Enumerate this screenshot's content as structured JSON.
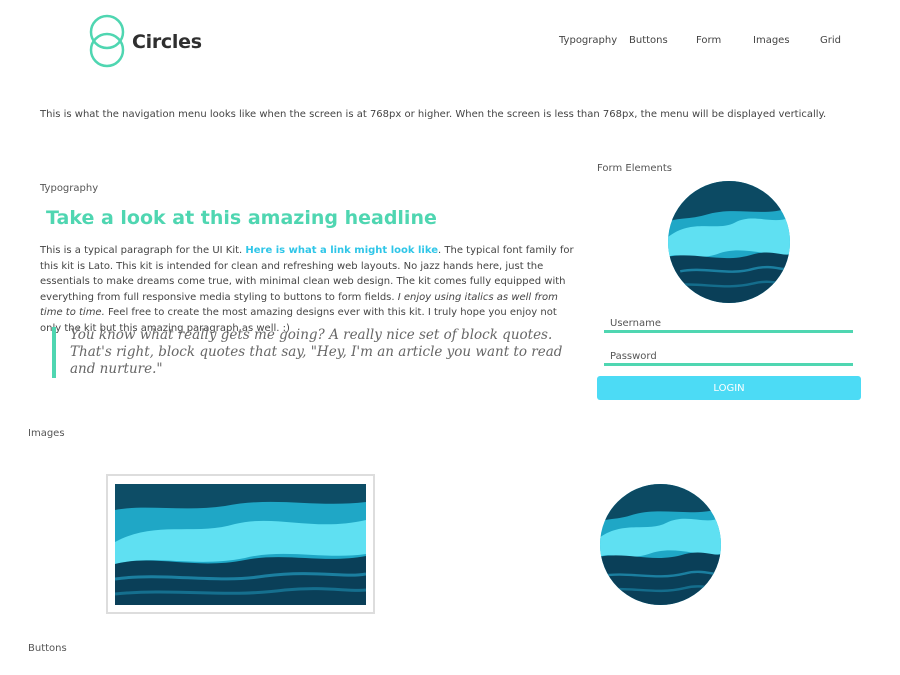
{
  "brand": {
    "name": "Circles",
    "accent_color": "#4fd6b1",
    "link_color": "#2fc6e8",
    "button_color": "#4cdbf5"
  },
  "nav": {
    "items": [
      {
        "label": "Typography"
      },
      {
        "label": "Buttons"
      },
      {
        "label": "Form"
      },
      {
        "label": "Images"
      },
      {
        "label": "Grid"
      }
    ]
  },
  "intro": "This is what the navigation menu looks like when the screen is at 768px or higher. When the screen is less than 768px, the menu will be displayed vertically.",
  "typography": {
    "label": "Typography",
    "headline": "Take a look at this amazing headline",
    "paragraph": {
      "part1": "This is a typical paragraph for the UI Kit. ",
      "link": "Here is what a link might look like",
      "part2": ". The typical font family for this kit is Lato. This kit is intended for clean and refreshing web layouts. No jazz hands here, just the essentials to make dreams come true, with minimal clean web design. The kit comes fully equipped with everything from full responsive media styling to buttons to form fields. ",
      "italic": "I enjoy using italics as well from time to time.",
      "part3": " Feel free to create the most amazing designs ever with this kit. I truly hope you enjoy not only the kit but this amazing paragraph as well. :)"
    },
    "blockquote": "You know what really gets me going? A really nice set of block quotes. That's right, block quotes that say, \"Hey, I'm an article you want to read and nurture.\""
  },
  "form": {
    "label": "Form Elements",
    "username_placeholder": "Username",
    "password_placeholder": "Password",
    "login_label": "LOGIN"
  },
  "images": {
    "label": "Images",
    "image_subject": "ocean-wave-photo"
  },
  "buttons": {
    "label": "Buttons"
  }
}
